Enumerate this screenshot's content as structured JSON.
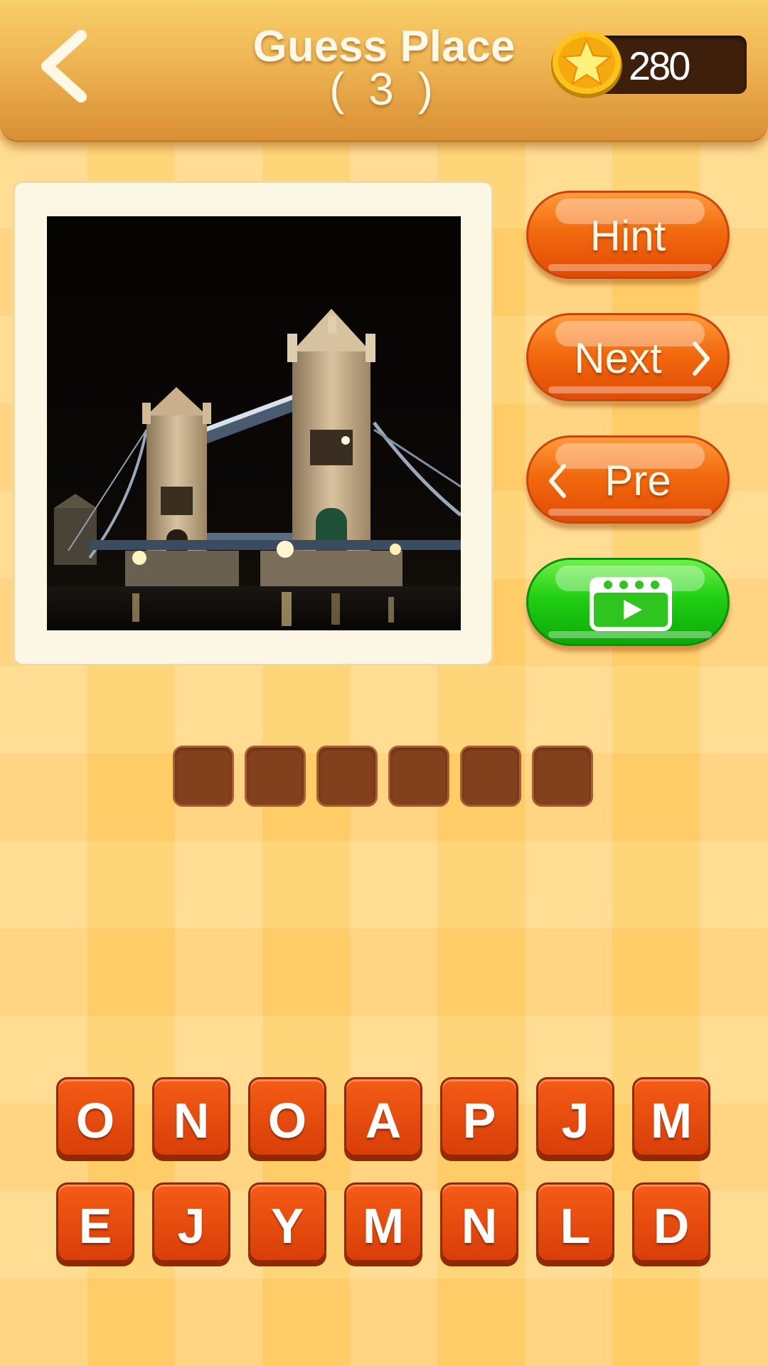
{
  "header": {
    "back_icon": "chevron-left-icon",
    "title": "Guess Place",
    "level": "( 3 )",
    "coin_icon": "star-coin-icon",
    "coins": "280"
  },
  "puzzle": {
    "image_subject": "Tower Bridge at night",
    "answer_length": 6
  },
  "buttons": {
    "hint": "Hint",
    "next": "Next",
    "pre": "Pre",
    "video_icon": "video-ad-icon"
  },
  "letters": {
    "row1": [
      "O",
      "N",
      "O",
      "A",
      "P",
      "J",
      "M"
    ],
    "row2": [
      "E",
      "J",
      "Y",
      "M",
      "N",
      "L",
      "D"
    ]
  },
  "colors": {
    "accent_orange": "#e8560a",
    "accent_green": "#16c410",
    "slot_brown": "#83401d",
    "header_gold": "#eeb452"
  }
}
